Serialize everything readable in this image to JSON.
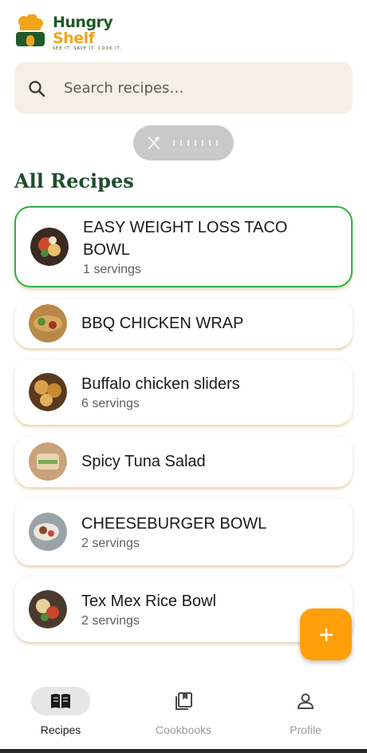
{
  "app": {
    "logo_line1": "Hungry",
    "logo_line2": "Shelf",
    "logo_tagline": "SEE IT. SAVE IT. COOK IT."
  },
  "search": {
    "placeholder": "Search recipes…",
    "icon": "search-icon"
  },
  "section": {
    "title": "All Recipes"
  },
  "recipes": [
    {
      "title_line1": "EASY WEIGHT LOSS TACO",
      "title_line2": "BOWL",
      "servings": "1 servings",
      "selected": true
    },
    {
      "title_line1": "BBQ CHICKEN WRAP",
      "title_line2": "",
      "servings": ""
    },
    {
      "title_line1": "Buffalo chicken sliders",
      "title_line2": "",
      "servings": "6 servings"
    },
    {
      "title_line1": "Spicy Tuna Salad",
      "title_line2": "",
      "servings": ""
    },
    {
      "title_line1": "CHEESEBURGER BOWL",
      "title_line2": "",
      "servings": "2 servings"
    },
    {
      "title_line1": "Tex Mex Rice Bowl",
      "title_line2": "",
      "servings": "2 servings"
    }
  ],
  "fab": {
    "icon": "plus-icon"
  },
  "nav": {
    "items": [
      {
        "label": "Recipes",
        "icon": "book-open-icon",
        "active": true
      },
      {
        "label": "Cookbooks",
        "icon": "bookmark-stack-icon",
        "active": false
      },
      {
        "label": "Profile",
        "icon": "person-icon",
        "active": false
      }
    ]
  },
  "colors": {
    "accent": "#ffa00a",
    "brand_green": "#1f4d2c",
    "selected_border": "#2fae4a",
    "search_bg": "#f5efe5"
  }
}
